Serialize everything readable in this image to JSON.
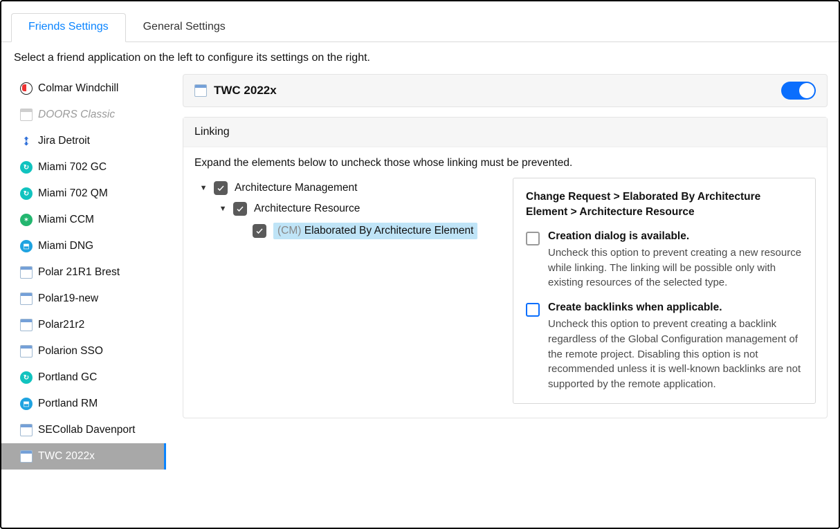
{
  "tabs": {
    "friends": "Friends Settings",
    "general": "General Settings",
    "active": "friends"
  },
  "instruction": "Select a friend application on the left to configure its settings on the right.",
  "sidebar": {
    "items": [
      {
        "label": "Colmar Windchill",
        "icon": "colmar"
      },
      {
        "label": "DOORS Classic",
        "icon": "window-gray",
        "disabled": true
      },
      {
        "label": "Jira Detroit",
        "icon": "jira"
      },
      {
        "label": "Miami 702 GC",
        "icon": "circle-teal"
      },
      {
        "label": "Miami 702 QM",
        "icon": "circle-teal"
      },
      {
        "label": "Miami CCM",
        "icon": "circle-green"
      },
      {
        "label": "Miami DNG",
        "icon": "circle-blue"
      },
      {
        "label": "Polar 21R1 Brest",
        "icon": "window"
      },
      {
        "label": "Polar19-new",
        "icon": "window"
      },
      {
        "label": "Polar21r2",
        "icon": "window"
      },
      {
        "label": "Polarion SSO",
        "icon": "window"
      },
      {
        "label": "Portland GC",
        "icon": "circle-teal"
      },
      {
        "label": "Portland RM",
        "icon": "circle-blue"
      },
      {
        "label": "SECollab Davenport",
        "icon": "window"
      },
      {
        "label": "TWC 2022x",
        "icon": "window",
        "selected": true
      }
    ]
  },
  "main": {
    "title": "TWC 2022x",
    "enabled": true,
    "section_title": "Linking",
    "section_sub": "Expand the elements below to uncheck those whose linking must be prevented.",
    "tree": {
      "lvl1": {
        "label": "Architecture Management",
        "checked": true
      },
      "lvl2": {
        "label": "Architecture Resource",
        "checked": true
      },
      "lvl3": {
        "tag": "(CM)",
        "label": "Elaborated By Architecture Element",
        "checked": true,
        "selected": true
      }
    },
    "detail": {
      "breadcrumb": "Change Request > Elaborated By Architecture Element > Architecture Resource",
      "opts": [
        {
          "title": "Creation dialog is available.",
          "desc": "Uncheck this option to prevent creating a new resource while linking. The linking will be possible only with existing resources of the selected type.",
          "checked": false,
          "style": "gray"
        },
        {
          "title": "Create backlinks when applicable.",
          "desc": "Uncheck this option to prevent creating a backlink regardless of the Global Configuration management of the remote project. Disabling this option is not recommended unless it is well-known backlinks are not supported by the remote application.",
          "checked": false,
          "style": "blue"
        }
      ]
    }
  }
}
